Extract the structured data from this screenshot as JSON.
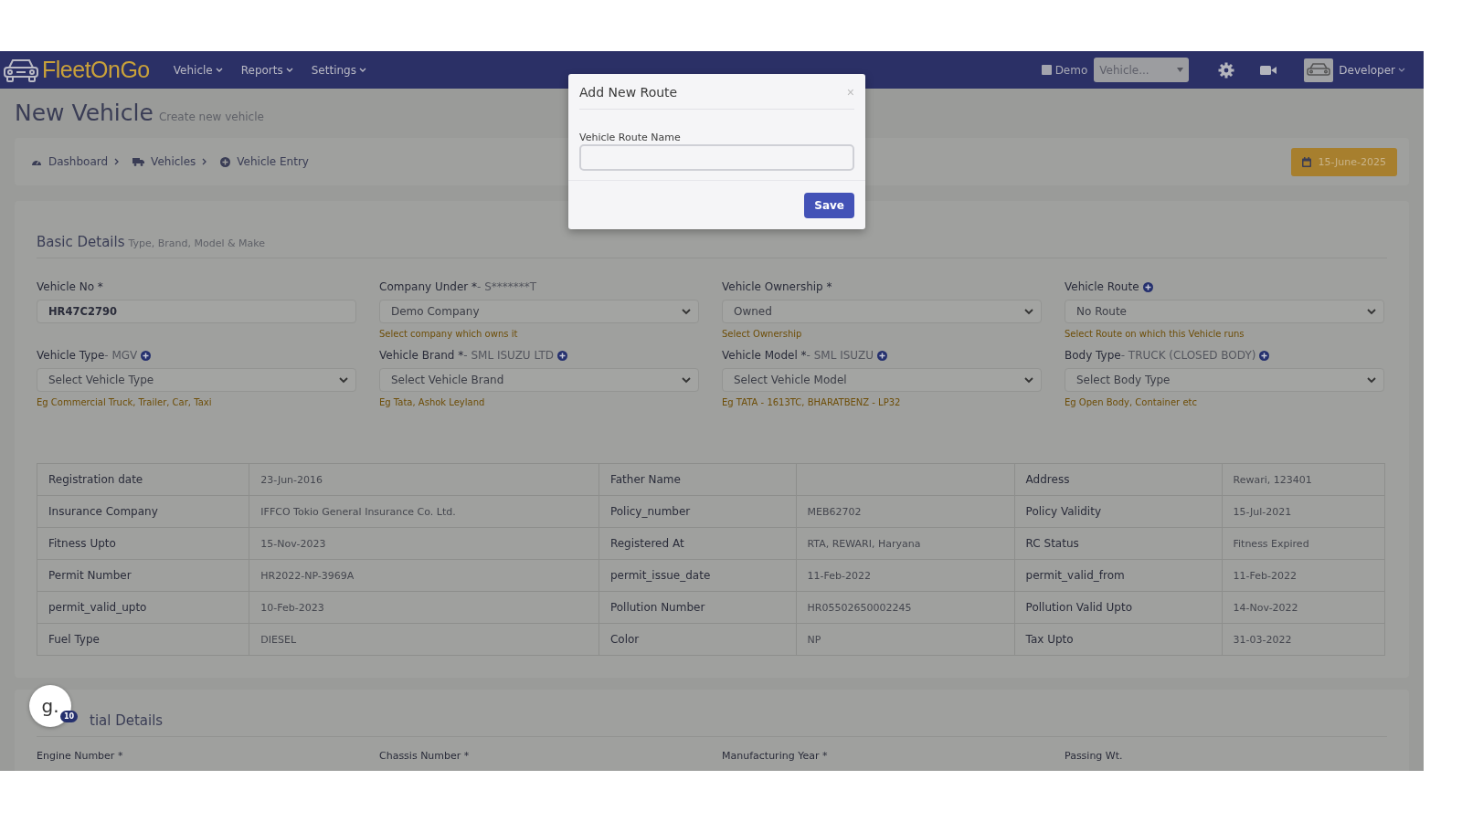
{
  "navbar": {
    "logo": "FleetOnGo",
    "menu": [
      {
        "label": "Vehicle"
      },
      {
        "label": "Reports"
      },
      {
        "label": "Settings"
      }
    ],
    "demo": {
      "label": "Demo",
      "checked": false
    },
    "vehicle_select": {
      "placeholder": "Vehicle..."
    },
    "user": "Developer"
  },
  "page": {
    "title": "New Vehicle",
    "subtitle": "Create new vehicle"
  },
  "breadcrumb": [
    {
      "label": "Dashboard"
    },
    {
      "label": "Vehicles"
    },
    {
      "label": "Vehicle Entry"
    }
  ],
  "date_button": "15-June-2025",
  "basic_details": {
    "title": "Basic Details",
    "subtitle": "Type, Brand, Model & Make",
    "fields": [
      {
        "kind": "input",
        "label": "Vehicle No *",
        "add": false,
        "value": "HR47C2790"
      },
      {
        "kind": "select",
        "label": "Company Under *",
        "extra": "- S*******T",
        "add": false,
        "value": "Demo Company",
        "hint": "Select company which owns it"
      },
      {
        "kind": "select",
        "label": "Vehicle Ownership *",
        "add": false,
        "value": "Owned",
        "hint": "Select Ownership"
      },
      {
        "kind": "select",
        "label": "Vehicle Route",
        "add": true,
        "value": "No Route",
        "hint": "Select Route on which this Vehicle runs"
      },
      {
        "kind": "select",
        "label": "Vehicle Type",
        "extra": "- MGV",
        "add": true,
        "value": "Select Vehicle Type",
        "hint": "Eg Commercial Truck, Trailer, Car, Taxi"
      },
      {
        "kind": "select",
        "label": "Vehicle Brand *",
        "extra": "- SML ISUZU LTD",
        "add": true,
        "value": "Select Vehicle Brand",
        "hint": "Eg Tata, Ashok Leyland"
      },
      {
        "kind": "select",
        "label": "Vehicle Model *",
        "extra": "- SML ISUZU",
        "add": true,
        "value": "Select Vehicle Model",
        "hint": "Eg TATA - 1613TC, BHARATBENZ - LP32"
      },
      {
        "kind": "select",
        "label": "Body Type",
        "extra": "- TRUCK (CLOSED BODY)",
        "add": true,
        "value": "Select Body Type",
        "hint": "Eg Open Body, Container etc"
      }
    ]
  },
  "details_table": [
    [
      {
        "label": "Registration date",
        "value": "23-Jun-2016"
      },
      {
        "label": "Father Name"
      },
      {
        "label": "Address",
        "value": "Rewari, 123401"
      }
    ],
    [
      {
        "label": "Insurance Company",
        "value": "IFFCO Tokio General Insurance Co. Ltd."
      },
      {
        "label": "Policy_number",
        "value": "MEB62702"
      },
      {
        "label": "Policy Validity",
        "value": "15-Jul-2021"
      }
    ],
    [
      {
        "label": "Fitness Upto",
        "value": "15-Nov-2023"
      },
      {
        "label": "Registered At",
        "value": "RTA, REWARI, Haryana"
      },
      {
        "label": "RC Status",
        "value": "Fitness Expired"
      }
    ],
    [
      {
        "label": "Permit Number",
        "value": "HR2022-NP-3969A"
      },
      {
        "label": "permit_issue_date",
        "value": "11-Feb-2022"
      },
      {
        "label": "permit_valid_from",
        "value": "11-Feb-2022"
      }
    ],
    [
      {
        "label": "permit_valid_upto",
        "value": "10-Feb-2023"
      },
      {
        "label": "Pollution Number",
        "value": "HR05502650002245"
      },
      {
        "label": "Pollution Valid Upto",
        "value": "14-Nov-2022"
      }
    ],
    [
      {
        "label": "Fuel Type",
        "value": "DIESEL"
      },
      {
        "label": "Color",
        "value": "NP"
      },
      {
        "label": "Tax Upto",
        "value": "31-03-2022"
      }
    ]
  ],
  "second_section": {
    "title": "tial Details",
    "labels": [
      "Engine Number *",
      "Chassis Number *",
      "Manufacturing Year *",
      "Passing Wt."
    ]
  },
  "chat_bubble": {
    "letter": "g.",
    "badge": "10"
  },
  "modal": {
    "title": "Add New Route",
    "close": "×",
    "field_label": "Vehicle Route Name",
    "save": "Save"
  }
}
